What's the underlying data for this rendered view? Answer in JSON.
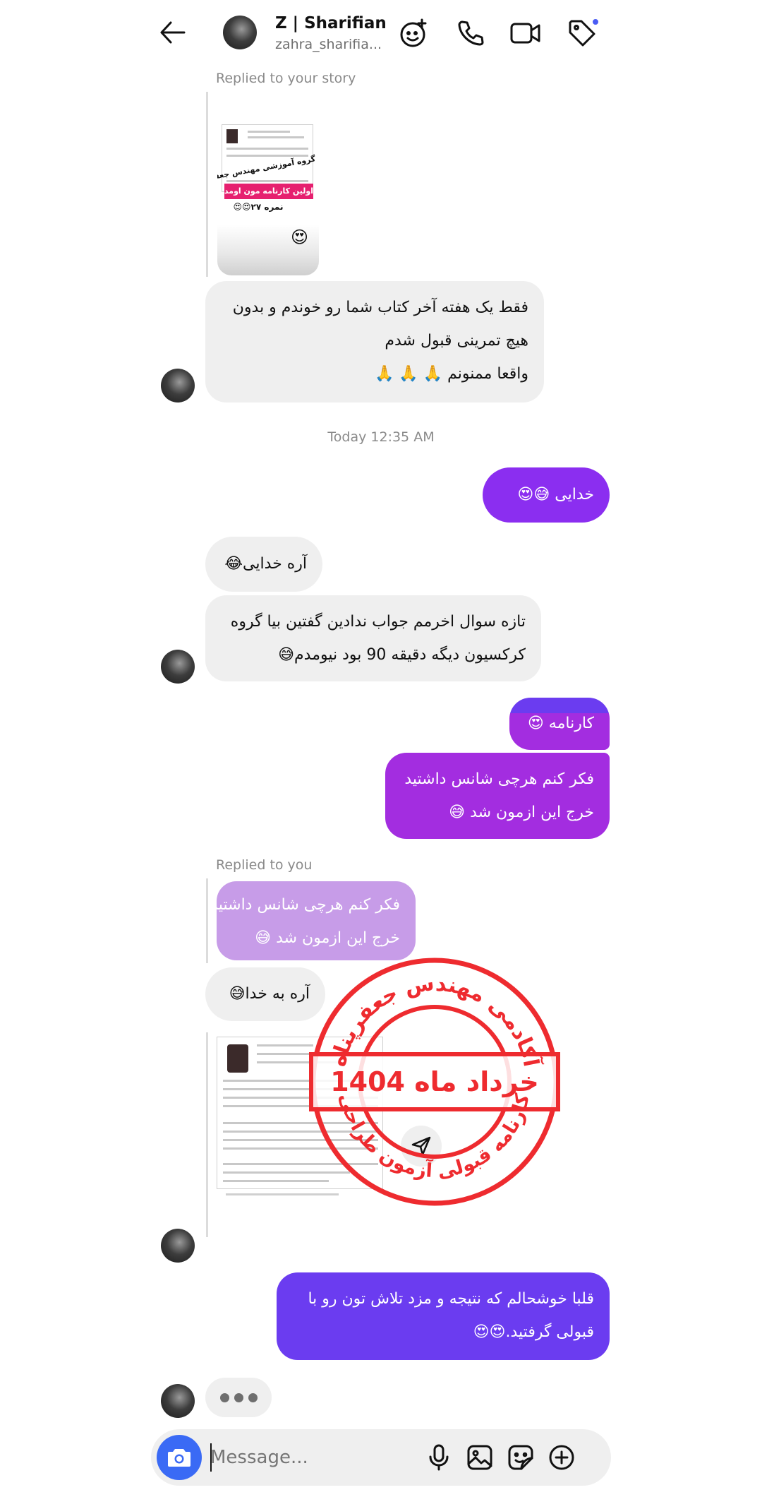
{
  "header": {
    "name": "Z | Sharifian",
    "username": "zahra_sharifia...",
    "back_icon": "arrow-left-icon",
    "icons": [
      "effects-icon",
      "phone-icon",
      "video-icon",
      "tag-icon"
    ],
    "notification_dot_color": "#4a5cf4"
  },
  "thread": {
    "story_reply_label": "Replied to your story",
    "story_reaction": "😍",
    "story_card": {
      "caption_group": "گروه آموزشی مهندس جعفرپناه",
      "caption_banner": "اولین کارنامه مون اومد😍",
      "caption_score": "نمره ۲۷😍😍"
    },
    "msg1_lines": [
      "فقط یک هفته آخر کتاب شما رو خوندم و بدون",
      "هیچ تمرینی قبول شدم",
      "واقعا ممنونم 🙏 🙏 🙏"
    ],
    "timestamp": "Today 12:35 AM",
    "msg2": "خدایی 😅😍",
    "msg3": "آره خدایی😂",
    "msg4_lines": [
      "تازه سوال اخرمم جواب ندادین گفتین بیا گروه",
      "کرکسیون دیگه دقیقه 90 بود نیومدم😅"
    ],
    "msg5": "کارنامه 😍",
    "msg6_lines": [
      "فکر کنم هرچی شانس داشتید",
      "خرج این ازمون شد 😅"
    ],
    "reply_label": "Replied to you",
    "quoted_lines": [
      "فکر کنم هرچی شانس داشتید",
      "خرج این ازمون شد 😅"
    ],
    "msg7": "آره به خدا😅",
    "msg8_lines": [
      "قلبا خوشحالم که نتیجه و مزد تلاش تون رو با",
      "قبولی گرفتید.😍😍"
    ],
    "stamp": {
      "top_text": "آکادمی مهندس جعفرپناه",
      "center_text": "خرداد ماه 1404",
      "bottom_text": "کارنامه قبولی آزمون طراحی",
      "color": "#ee2b2f"
    }
  },
  "composer": {
    "placeholder": "Message...",
    "icons": [
      "camera-icon",
      "microphone-icon",
      "gallery-icon",
      "sticker-icon",
      "add-icon"
    ],
    "camera_button_color": "#3a6af5"
  }
}
